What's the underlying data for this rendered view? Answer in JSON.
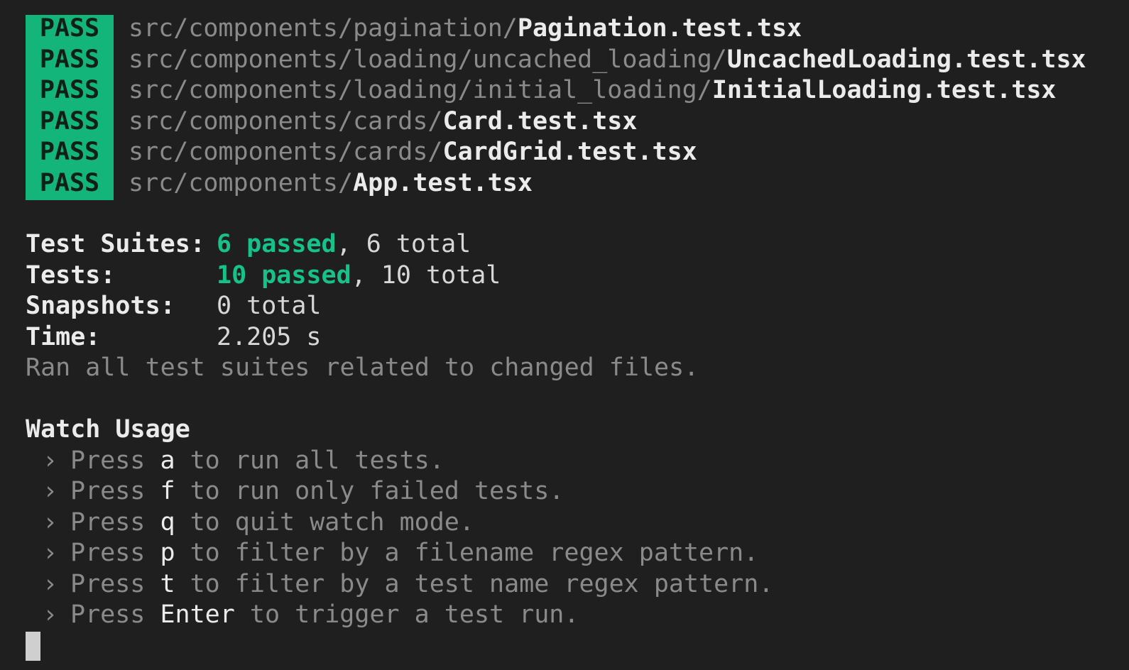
{
  "results": [
    {
      "status": "PASS",
      "dir": "src/components/pagination/",
      "file": "Pagination.test.tsx"
    },
    {
      "status": "PASS",
      "dir": "src/components/loading/uncached_loading/",
      "file": "UncachedLoading.test.tsx"
    },
    {
      "status": "PASS",
      "dir": "src/components/loading/initial_loading/",
      "file": "InitialLoading.test.tsx"
    },
    {
      "status": "PASS",
      "dir": "src/components/cards/",
      "file": "Card.test.tsx"
    },
    {
      "status": "PASS",
      "dir": "src/components/cards/",
      "file": "CardGrid.test.tsx"
    },
    {
      "status": "PASS",
      "dir": "src/components/",
      "file": "App.test.tsx"
    }
  ],
  "summary": {
    "suites_label": "Test Suites:",
    "suites_passed": "6 passed",
    "suites_total": ", 6 total",
    "tests_label": "Tests:",
    "tests_passed": "10 passed",
    "tests_total": ", 10 total",
    "snapshots_label": "Snapshots:",
    "snapshots_value": "0 total",
    "time_label": "Time:",
    "time_value": "2.205 s",
    "ran_note": "Ran all test suites related to changed files."
  },
  "watch": {
    "title": "Watch Usage",
    "chevron": "›",
    "press_word": "Press",
    "items": [
      {
        "key": "a",
        "desc": " to run all tests."
      },
      {
        "key": "f",
        "desc": " to run only failed tests."
      },
      {
        "key": "q",
        "desc": " to quit watch mode."
      },
      {
        "key": "p",
        "desc": " to filter by a filename regex pattern."
      },
      {
        "key": "t",
        "desc": " to filter by a test name regex pattern."
      },
      {
        "key": "Enter",
        "desc": " to trigger a test run."
      }
    ]
  },
  "colors": {
    "background": "#1f1f1f",
    "pass_badge": "#13b57a",
    "passed_text": "#16c28a",
    "dim_text": "#8a8a8a",
    "bright_text": "#ebebeb"
  }
}
